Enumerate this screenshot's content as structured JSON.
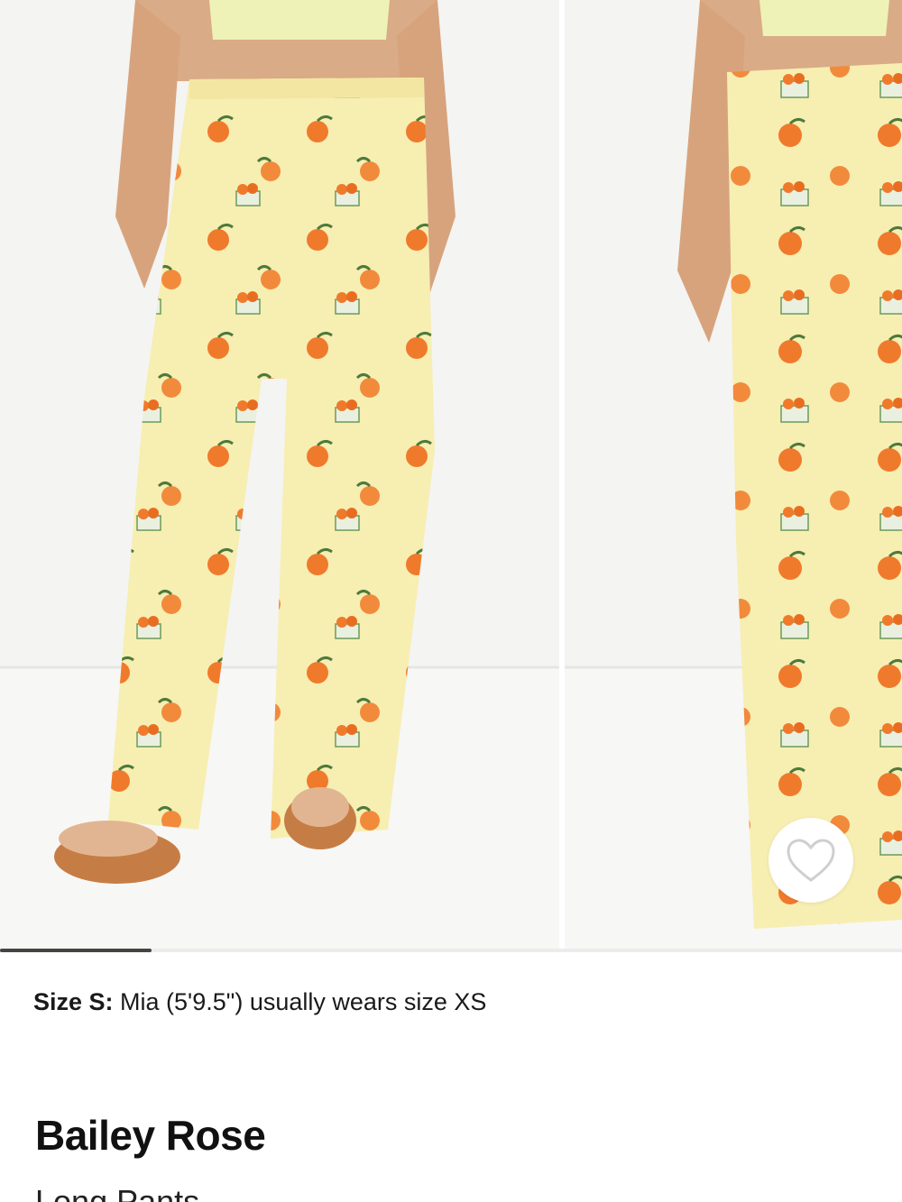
{
  "gallery": {
    "images": [
      {
        "description": "front view of peach print long pants with sandals"
      },
      {
        "description": "side view of peach print long pants"
      }
    ],
    "scroll_progress": 0.168
  },
  "favorite": {
    "icon": "heart-outline-icon"
  },
  "size_note": {
    "label": "Size S:",
    "text": " Mia (5'9.5\") usually wears size XS"
  },
  "product": {
    "brand": "Bailey Rose",
    "type": "Long Pants"
  },
  "colors": {
    "pants": "#f7eeb2",
    "peach": "#f07a2c",
    "leaf": "#4d7a3a",
    "scroll_thumb": "#444444",
    "background": "#f3f3f1"
  }
}
